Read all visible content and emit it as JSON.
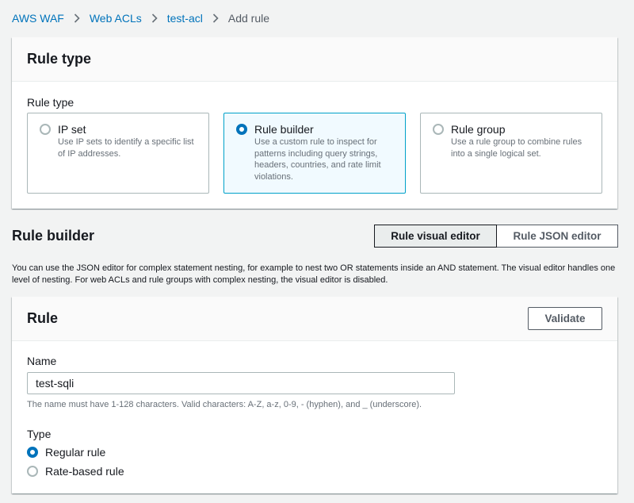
{
  "breadcrumb": {
    "items": [
      "AWS WAF",
      "Web ACLs",
      "test-acl"
    ],
    "current": "Add rule"
  },
  "rule_type_panel": {
    "title": "Rule type",
    "field_label": "Rule type",
    "options": [
      {
        "title": "IP set",
        "description": "Use IP sets to identify a specific list of IP addresses.",
        "selected": false
      },
      {
        "title": "Rule builder",
        "description": "Use a custom rule to inspect for patterns including query strings, headers, countries, and rate limit violations.",
        "selected": true
      },
      {
        "title": "Rule group",
        "description": "Use a rule group to combine rules into a single logical set.",
        "selected": false
      }
    ]
  },
  "rule_builder": {
    "title": "Rule builder",
    "editor_toggle": {
      "visual_label": "Rule visual editor",
      "json_label": "Rule JSON editor",
      "active": "visual"
    },
    "description": "You can use the JSON editor for complex statement nesting, for example to nest two OR statements inside an AND statement. The visual editor handles one level of nesting. For web ACLs and rule groups with complex nesting, the visual editor is disabled."
  },
  "rule_panel": {
    "title": "Rule",
    "validate_label": "Validate",
    "name_label": "Name",
    "name_value": "test-sqli",
    "name_hint": "The name must have 1-128 characters. Valid characters: A-Z, a-z, 0-9, - (hyphen), and _ (underscore).",
    "type_label": "Type",
    "type_options": [
      {
        "label": "Regular rule",
        "selected": true
      },
      {
        "label": "Rate-based rule",
        "selected": false
      }
    ]
  },
  "colors": {
    "link": "#0073bb",
    "selected_border": "#00a1c9",
    "selected_bg": "#f1faff",
    "page_bg": "#f2f3f3"
  }
}
